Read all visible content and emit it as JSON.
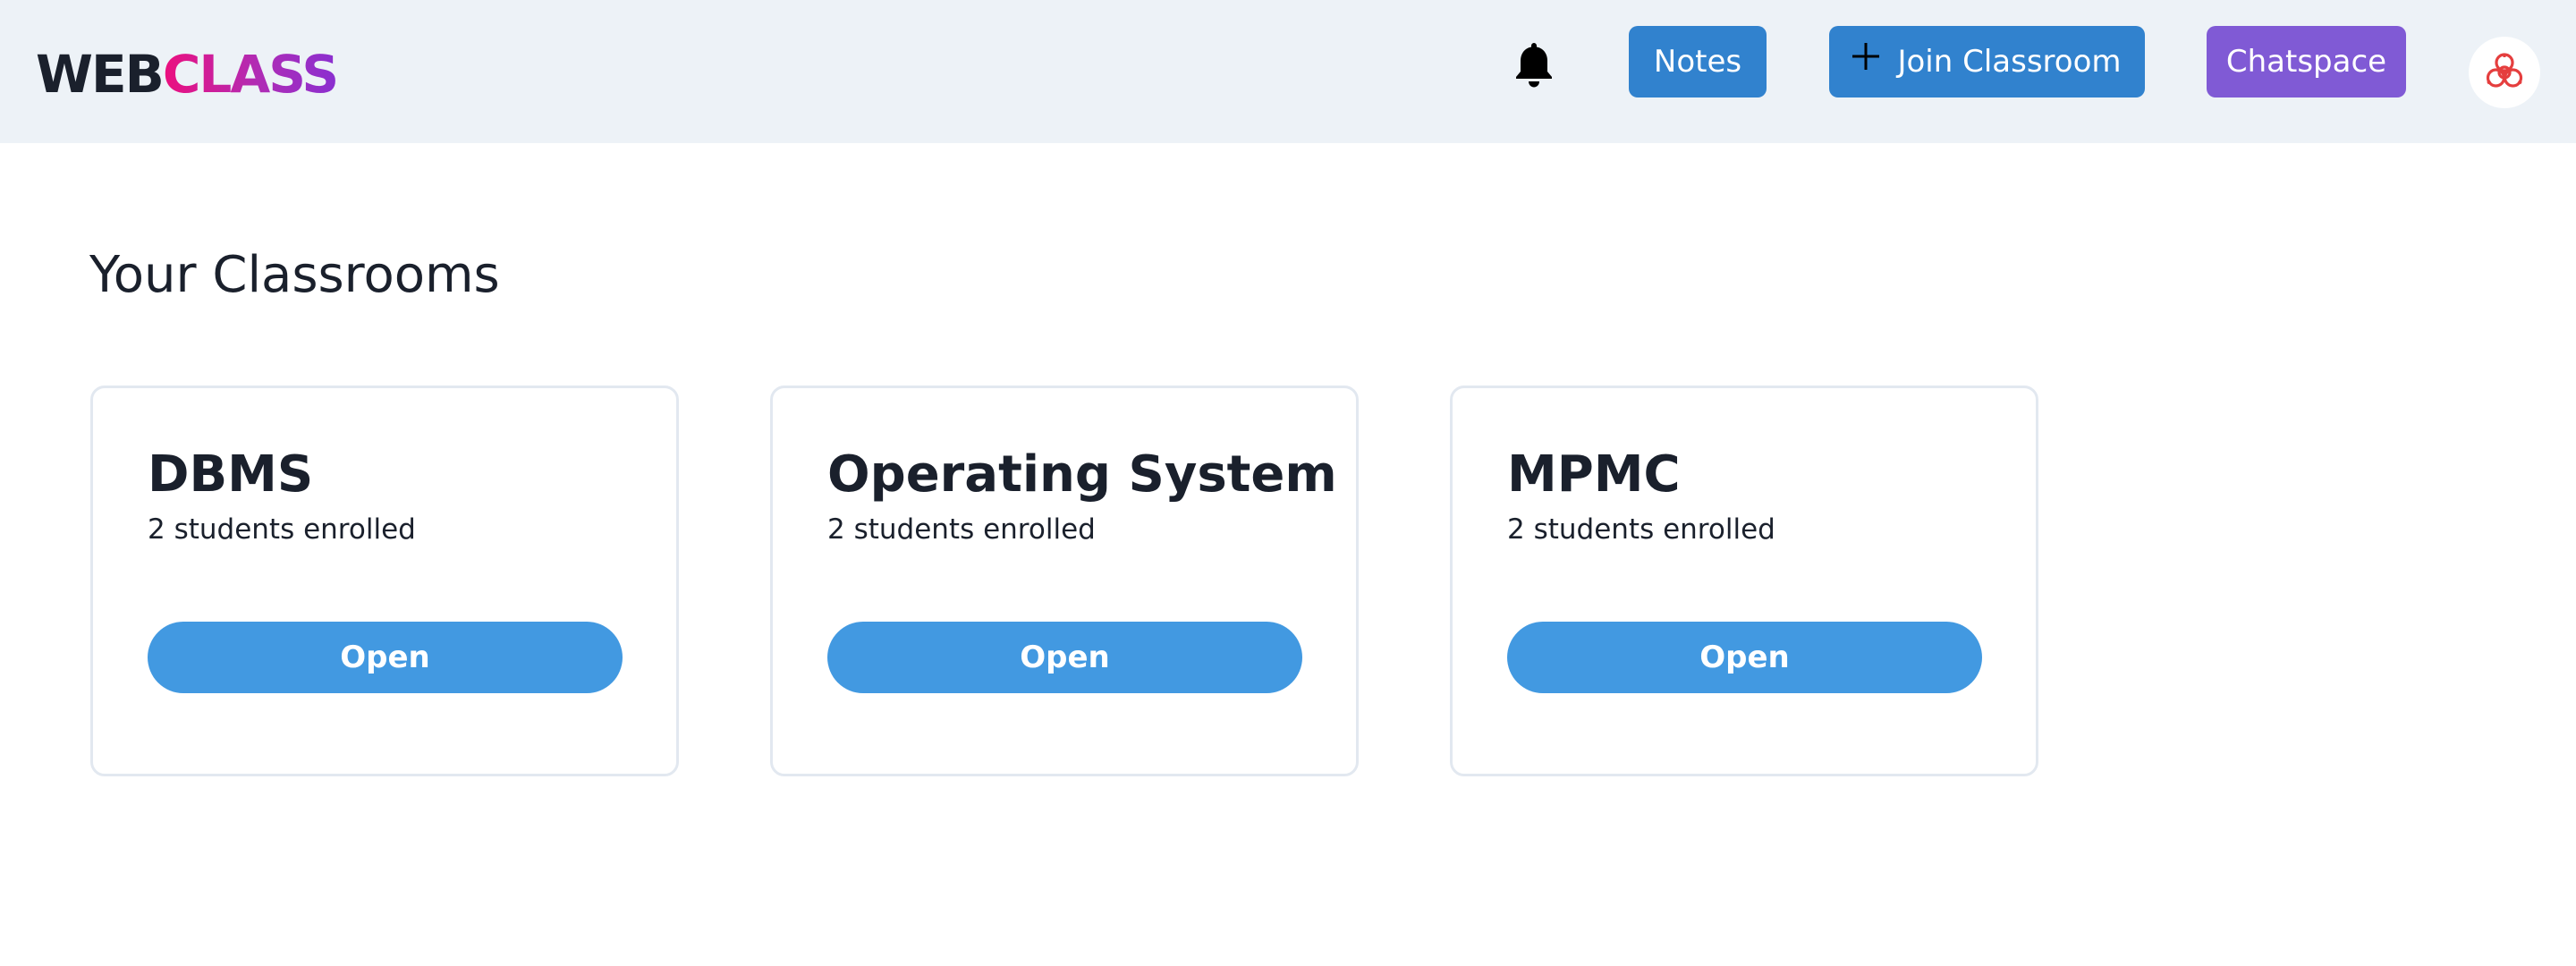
{
  "header": {
    "logo_part1": "WEB",
    "logo_part2": "CLASS",
    "notes_label": "Notes",
    "join_label": "Join Classroom",
    "chat_label": "Chatspace"
  },
  "icons": {
    "notifications": "bell-icon",
    "join": "plus-icon",
    "avatar": "biohazard-icon"
  },
  "colors": {
    "header_bg": "#edf2f7",
    "primary_button": "#3182ce",
    "chat_button": "#805ad5",
    "open_button": "#4299e1",
    "logo_gradient": [
      "#ec0f7e",
      "#8a2fd0"
    ],
    "avatar_icon": "#e53e3e"
  },
  "main": {
    "title": "Your Classrooms",
    "classrooms": [
      {
        "name": "DBMS",
        "enrolled": "2 students enrolled",
        "action": "Open"
      },
      {
        "name": "Operating System",
        "enrolled": "2 students enrolled",
        "action": "Open"
      },
      {
        "name": "MPMC",
        "enrolled": "2 students enrolled",
        "action": "Open"
      }
    ]
  }
}
